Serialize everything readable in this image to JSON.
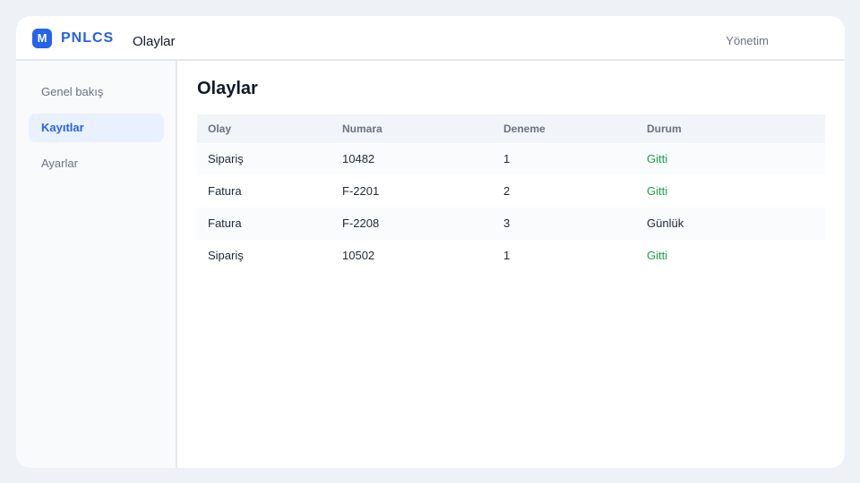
{
  "header": {
    "logo_letter": "M",
    "brand": "PNLCS",
    "page_title": "Olaylar",
    "admin_label": "Yönetim"
  },
  "sidebar": {
    "items": [
      {
        "label": "Genel bakış",
        "active": false
      },
      {
        "label": "Kayıtlar",
        "active": true
      },
      {
        "label": "Ayarlar",
        "active": false
      }
    ]
  },
  "main": {
    "title": "Olaylar",
    "table": {
      "columns": [
        "Olay",
        "Numara",
        "Deneme",
        "Durum"
      ],
      "rows": [
        {
          "event": "Sipariş",
          "number": "10482",
          "attempt": "1",
          "status": "Gitti",
          "status_color": "#16a34a"
        },
        {
          "event": "Fatura",
          "number": "F-2201",
          "attempt": "2",
          "status": "Gitti",
          "status_color": "#16a34a"
        },
        {
          "event": "Fatura",
          "number": "F-2208",
          "attempt": "3",
          "status": "Günlük",
          "status_color": "#1f2937"
        },
        {
          "event": "Sipariş",
          "number": "10502",
          "attempt": "1",
          "status": "Gitti",
          "status_color": "#16a34a"
        }
      ]
    }
  },
  "colors": {
    "accent": "#2563eb",
    "success": "#16a34a"
  }
}
